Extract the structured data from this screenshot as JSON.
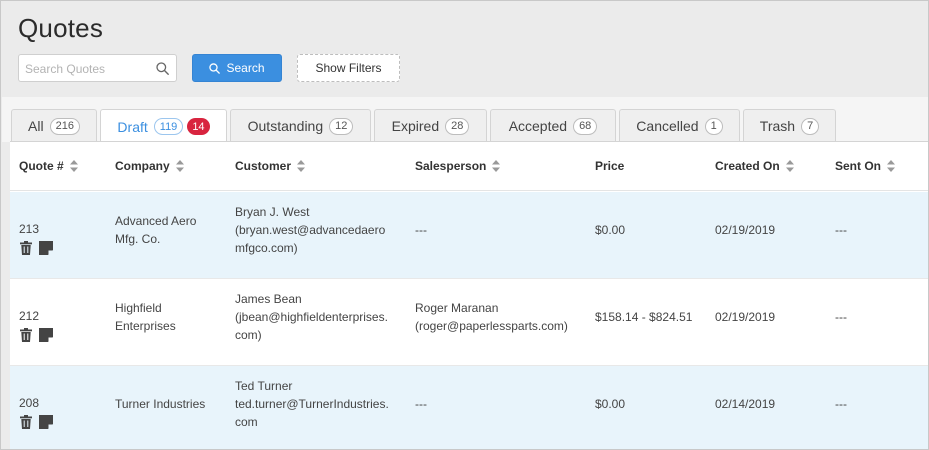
{
  "page": {
    "title": "Quotes"
  },
  "search": {
    "placeholder": "Search Quotes",
    "value": "",
    "button_label": "Search"
  },
  "filters": {
    "button_label": "Show Filters"
  },
  "tabs": [
    {
      "label": "All",
      "count": "216"
    },
    {
      "label": "Draft",
      "count": "119",
      "badge": "14"
    },
    {
      "label": "Outstanding",
      "count": "12"
    },
    {
      "label": "Expired",
      "count": "28"
    },
    {
      "label": "Accepted",
      "count": "68"
    },
    {
      "label": "Cancelled",
      "count": "1"
    },
    {
      "label": "Trash",
      "count": "7"
    }
  ],
  "columns": {
    "quote_num": "Quote #",
    "company": "Company",
    "customer": "Customer",
    "salesperson": "Salesperson",
    "price": "Price",
    "created_on": "Created On",
    "sent_on": "Sent On"
  },
  "rows": [
    {
      "quote_num": "213",
      "company": "Advanced Aero\nMfg. Co.",
      "customer": "Bryan J. West\n(bryan.west@advancedaero\nmfgco.com)",
      "salesperson": "---",
      "price": "$0.00",
      "created_on": "02/19/2019",
      "sent_on": "---"
    },
    {
      "quote_num": "212",
      "company": "Highfield\nEnterprises",
      "customer": "James Bean\n(jbean@highfieldenterprises.\ncom)",
      "salesperson": "Roger Maranan\n(roger@paperlessparts.com)",
      "price": "$158.14 - $824.51",
      "created_on": "02/19/2019",
      "sent_on": "---"
    },
    {
      "quote_num": "208",
      "company": "Turner Industries",
      "customer": "Ted Turner\nted.turner@TurnerIndustries.\ncom",
      "salesperson": "---",
      "price": "$0.00",
      "created_on": "02/14/2019",
      "sent_on": "---"
    }
  ],
  "icons": {
    "search": "search-icon",
    "sort": "sort-icon",
    "trash": "trash-icon",
    "note": "note-icon"
  },
  "colors": {
    "accent": "#3b8fe0",
    "badge_red": "#d8243f",
    "row_shade": "#e8f4fb"
  }
}
